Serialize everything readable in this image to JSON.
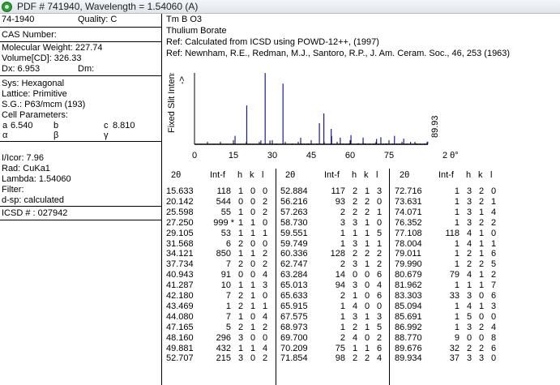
{
  "window": {
    "title": "PDF # 741940,  Wavelength = 1.54060   (A)"
  },
  "card": {
    "pdf_number": "74-1940",
    "quality": "Quality: C",
    "cas_label": "CAS Number:",
    "mol_weight": "Molecular Weight:   227.74",
    "volume": "Volume[CD]:     326.33",
    "dx": "Dx:  6.953",
    "dm": "Dm:",
    "sys": "Sys: Hexagonal",
    "lattice": "Lattice: Primitive",
    "sg": "S.G.: P63/mcm (193)",
    "cell_params": "Cell Parameters:",
    "a_label": "a",
    "a_value": "6.540",
    "b_label": "b",
    "c_label": "c",
    "c_value": "8.810",
    "alpha": "α",
    "beta": "β",
    "gamma": "γ",
    "icor": "I/Icor:   7.96",
    "rad": "Rad: CuKa1",
    "lambda": "Lambda: 1.54060",
    "filter": "Filter:",
    "dsp": "d-sp: calculated",
    "icsd": "ICSD # : 027942"
  },
  "header": {
    "formula": "Tm B O3",
    "name": "Thulium Borate",
    "ref1": "Ref:  Calculated from ICSD using POWD-12++, (1997)",
    "ref2": "Ref:  Newnham, R.E., Redman, M.J., Santoro, R.P., J. Am. Ceram. Soc., 46, 253 (1963)"
  },
  "chart_data": {
    "type": "bar",
    "ylabel": "Fixed  Slit  Intensity",
    "ylabel_arrow": "->",
    "xlabel": "2 θ°",
    "x_ticks": [
      "0",
      "15",
      "30",
      "45",
      "60",
      "75"
    ],
    "x_tick_values": [
      0,
      15,
      30,
      45,
      60,
      75
    ],
    "xlim": [
      0,
      90
    ],
    "ylim": [
      0,
      1000
    ],
    "marker_label": "89.93",
    "x": [
      15.633,
      20.142,
      25.598,
      27.25,
      29.105,
      31.568,
      34.121,
      37.734,
      40.943,
      41.287,
      42.18,
      43.469,
      44.08,
      47.165,
      48.16,
      49.881,
      52.707,
      52.884,
      56.216,
      57.263,
      58.73,
      59.551,
      59.749,
      60.336,
      62.747,
      63.284,
      65.013,
      65.633,
      65.915,
      67.575,
      68.973,
      69.7,
      70.209,
      71.854,
      72.716,
      73.631,
      74.071,
      76.352,
      77.108,
      78.004,
      79.011,
      79.99,
      80.679,
      81.962,
      83.303,
      85.094,
      85.691,
      86.992,
      88.77,
      89.676,
      89.934
    ],
    "values": [
      118,
      544,
      55,
      999,
      53,
      6,
      850,
      7,
      91,
      10,
      7,
      1,
      7,
      5,
      296,
      432,
      215,
      117,
      93,
      2,
      3,
      1,
      1,
      128,
      2,
      14,
      94,
      2,
      1,
      1,
      1,
      2,
      75,
      98,
      1,
      1,
      1,
      1,
      118,
      1,
      1,
      1,
      79,
      1,
      33,
      1,
      1,
      1,
      9,
      32,
      37
    ]
  },
  "table": {
    "headers": [
      "2θ",
      "Int-f",
      "h",
      "k",
      "l"
    ],
    "columns": [
      [
        [
          "15.633",
          "118",
          "1",
          "0",
          "0"
        ],
        [
          "20.142",
          "544",
          "0",
          "0",
          "2"
        ],
        [
          "25.598",
          "55",
          "1",
          "0",
          "2"
        ],
        [
          "27.250",
          "999 *",
          "1",
          "1",
          "0"
        ],
        [
          "29.105",
          "53",
          "1",
          "1",
          "1"
        ],
        [
          "31.568",
          "6",
          "2",
          "0",
          "0"
        ],
        [
          "34.121",
          "850",
          "1",
          "1",
          "2"
        ],
        [
          "37.734",
          "7",
          "2",
          "0",
          "2"
        ],
        [
          "40.943",
          "91",
          "0",
          "0",
          "4"
        ],
        [
          "41.287",
          "10",
          "1",
          "1",
          "3"
        ],
        [
          "42.180",
          "7",
          "2",
          "1",
          "0"
        ],
        [
          "43.469",
          "1",
          "2",
          "1",
          "1"
        ],
        [
          "44.080",
          "7",
          "1",
          "0",
          "4"
        ],
        [
          "47.165",
          "5",
          "2",
          "1",
          "2"
        ],
        [
          "48.160",
          "296",
          "3",
          "0",
          "0"
        ],
        [
          "49.881",
          "432",
          "1",
          "1",
          "4"
        ],
        [
          "52.707",
          "215",
          "3",
          "0",
          "2"
        ]
      ],
      [
        [
          "52.884",
          "117",
          "2",
          "1",
          "3"
        ],
        [
          "56.216",
          "93",
          "2",
          "2",
          "0"
        ],
        [
          "57.263",
          "2",
          "2",
          "2",
          "1"
        ],
        [
          "58.730",
          "3",
          "3",
          "1",
          "0"
        ],
        [
          "59.551",
          "1",
          "1",
          "1",
          "5"
        ],
        [
          "59.749",
          "1",
          "3",
          "1",
          "1"
        ],
        [
          "60.336",
          "128",
          "2",
          "2",
          "2"
        ],
        [
          "62.747",
          "2",
          "3",
          "1",
          "2"
        ],
        [
          "63.284",
          "14",
          "0",
          "0",
          "6"
        ],
        [
          "65.013",
          "94",
          "3",
          "0",
          "4"
        ],
        [
          "65.633",
          "2",
          "1",
          "0",
          "6"
        ],
        [
          "65.915",
          "1",
          "4",
          "0",
          "0"
        ],
        [
          "67.575",
          "1",
          "3",
          "1",
          "3"
        ],
        [
          "68.973",
          "1",
          "2",
          "1",
          "5"
        ],
        [
          "69.700",
          "2",
          "4",
          "0",
          "2"
        ],
        [
          "70.209",
          "75",
          "1",
          "1",
          "6"
        ],
        [
          "71.854",
          "98",
          "2",
          "2",
          "4"
        ]
      ],
      [
        [
          "72.716",
          "1",
          "3",
          "2",
          "0"
        ],
        [
          "73.631",
          "1",
          "3",
          "2",
          "1"
        ],
        [
          "74.071",
          "1",
          "3",
          "1",
          "4"
        ],
        [
          "76.352",
          "1",
          "3",
          "2",
          "2"
        ],
        [
          "77.108",
          "118",
          "4",
          "1",
          "0"
        ],
        [
          "78.004",
          "1",
          "4",
          "1",
          "1"
        ],
        [
          "79.011",
          "1",
          "2",
          "1",
          "6"
        ],
        [
          "79.990",
          "1",
          "2",
          "2",
          "5"
        ],
        [
          "80.679",
          "79",
          "4",
          "1",
          "2"
        ],
        [
          "81.962",
          "1",
          "1",
          "1",
          "7"
        ],
        [
          "83.303",
          "33",
          "3",
          "0",
          "6"
        ],
        [
          "85.094",
          "1",
          "4",
          "1",
          "3"
        ],
        [
          "85.691",
          "1",
          "5",
          "0",
          "0"
        ],
        [
          "86.992",
          "1",
          "3",
          "2",
          "4"
        ],
        [
          "88.770",
          "9",
          "0",
          "0",
          "8"
        ],
        [
          "89.676",
          "32",
          "2",
          "2",
          "6"
        ],
        [
          "89.934",
          "37",
          "3",
          "3",
          "0"
        ]
      ]
    ]
  },
  "colors": {
    "peak": "#1a1aa0",
    "axis": "#000000"
  }
}
